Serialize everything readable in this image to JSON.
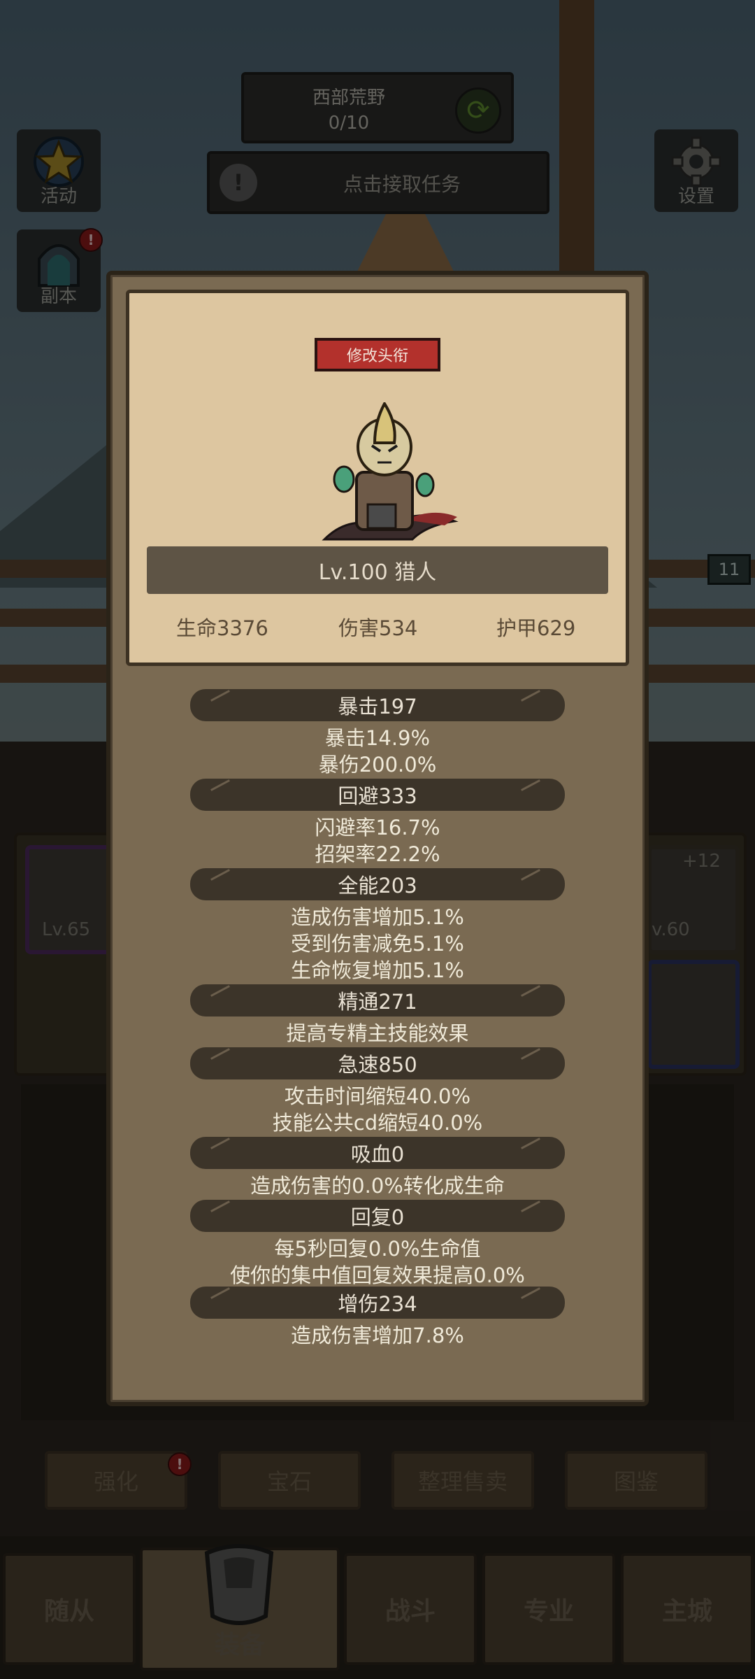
{
  "hud": {
    "zone_name": "西部荒野",
    "zone_progress": "0/10",
    "quest_text": "点击接取任务",
    "quest_icon": "!",
    "activity_label": "活动",
    "dungeon_label": "副本",
    "settings_label": "设置",
    "dungeon_badge": "!",
    "enemy_level": "11"
  },
  "background": {
    "slot_left_level": "Lv.65",
    "slot_right_level": "v.60",
    "slot_right_plus": "+12"
  },
  "actions": {
    "enhance": "强化",
    "enhance_badge": "!",
    "gem": "宝石",
    "sell": "整理售卖",
    "codex": "图鉴"
  },
  "tabs": {
    "followers": "随从",
    "equipment": "装备",
    "battle": "战斗",
    "profession": "专业",
    "city": "主城"
  },
  "character": {
    "edit_title_button": "修改头衔",
    "level_name": "Lv.100 猎人",
    "hp": "生命3376",
    "damage": "伤害534",
    "armor": "护甲629"
  },
  "stats": {
    "crit": {
      "title": "暴击197",
      "lines": [
        "暴击14.9%",
        "暴伤200.0%"
      ]
    },
    "dodge": {
      "title": "回避333",
      "lines": [
        "闪避率16.7%",
        "招架率22.2%"
      ]
    },
    "versatility": {
      "title": "全能203",
      "lines": [
        "造成伤害增加5.1%",
        "受到伤害减免5.1%",
        "生命恢复增加5.1%"
      ]
    },
    "mastery": {
      "title": "精通271",
      "lines": [
        "提高专精主技能效果"
      ]
    },
    "haste": {
      "title": "急速850",
      "lines": [
        "攻击时间缩短40.0%",
        "技能公共cd缩短40.0%"
      ]
    },
    "leech": {
      "title": "吸血0",
      "lines": [
        "造成伤害的0.0%转化成生命"
      ]
    },
    "regen": {
      "title": "回复0",
      "lines": [
        "每5秒回复0.0%生命值",
        "使你的集中值回复效果提高0.0%"
      ]
    },
    "dmg_increase": {
      "title": "增伤234",
      "lines": [
        "造成伤害增加7.8%"
      ]
    }
  },
  "colors": {
    "panel_bg": "#7a6a52",
    "card_bg": "#ddc6a0",
    "stat_bar_bg": "#3c3429",
    "edit_button": "#b3312c"
  }
}
